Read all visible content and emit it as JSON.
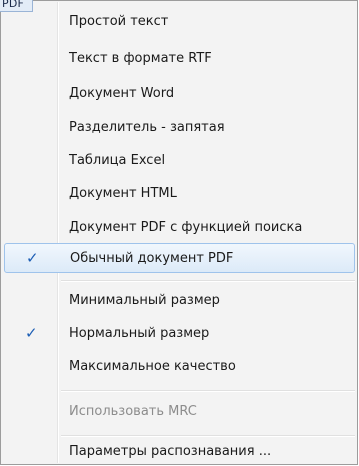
{
  "corner_tab": {
    "text": "PDF"
  },
  "menu": {
    "items": [
      {
        "label": "Простой текст"
      },
      {
        "label": "Текст в формате RTF"
      },
      {
        "label": "Документ Word"
      },
      {
        "label": "Разделитель - запятая"
      },
      {
        "label": "Таблица Excel"
      },
      {
        "label": "Документ HTML"
      },
      {
        "label": "Документ PDF с функцией поиска"
      },
      {
        "label": "Обычный документ PDF",
        "checked": true,
        "highlighted": true
      },
      {
        "label": "Минимальный размер"
      },
      {
        "label": "Нормальный размер",
        "checked": true
      },
      {
        "label": "Максимальное качество"
      },
      {
        "label": "Использовать MRC",
        "disabled": true
      },
      {
        "label": "Параметры распознавания ..."
      }
    ],
    "check_glyph": "✓"
  }
}
